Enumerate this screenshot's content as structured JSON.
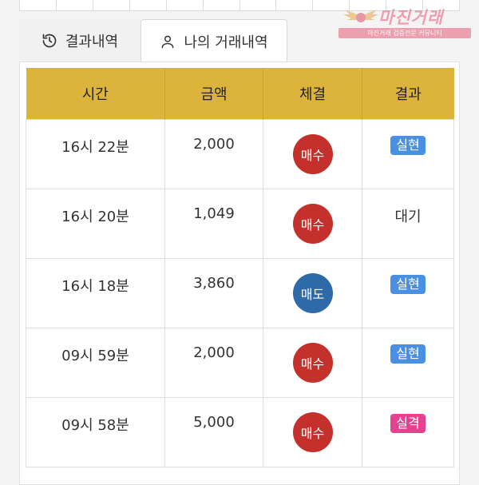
{
  "watermark": {
    "title": "마진거래",
    "subtitle": "마진거래 검증전문 커뮤니티"
  },
  "tabs": [
    {
      "label": "결과내역",
      "icon": "history-icon"
    },
    {
      "label": "나의 거래내역",
      "icon": "user-icon"
    }
  ],
  "table": {
    "headers": [
      "시간",
      "금액",
      "체결",
      "결과"
    ],
    "rows": [
      {
        "time": "16시 22분",
        "amount": "2,000",
        "exec": "매수",
        "exec_type": "buy",
        "result": "실현",
        "result_type": "hit"
      },
      {
        "time": "16시 20분",
        "amount": "1,049",
        "exec": "매수",
        "exec_type": "buy",
        "result": "대기",
        "result_type": "plain"
      },
      {
        "time": "16시 18분",
        "amount": "3,860",
        "exec": "매도",
        "exec_type": "sell",
        "result": "실현",
        "result_type": "hit"
      },
      {
        "time": "09시 59분",
        "amount": "2,000",
        "exec": "매수",
        "exec_type": "buy",
        "result": "실현",
        "result_type": "hit"
      },
      {
        "time": "09시 58분",
        "amount": "5,000",
        "exec": "매수",
        "exec_type": "buy",
        "result": "실격",
        "result_type": "miss"
      }
    ]
  },
  "colors": {
    "header_bg": "#dcb43b",
    "buy": "#c4302b",
    "sell": "#2f6aa8",
    "hit": "#4a90e2",
    "miss": "#e6408f"
  }
}
